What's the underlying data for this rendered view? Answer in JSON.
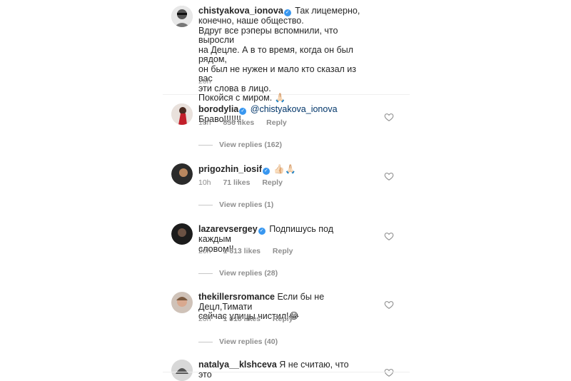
{
  "main_comment": {
    "username": "chistyakova_ionova",
    "lines": [
      "Так лицемерно,",
      "конечно, наше общество.",
      "Вдруг все рэперы вспомнили, что выросли",
      "на Децле. А в то время, когда он был рядом,",
      "он был не нужен и мало кто сказал из вас",
      "эти слова в лицо.",
      "Покойся с миром. 🙏🏻"
    ],
    "time": "20h"
  },
  "replies": [
    {
      "username": "borodylia",
      "mention": "@chistyakova_ionova",
      "text": " Браво!!!!!!!",
      "time": "18h",
      "likes": "856 likes",
      "reply_label": "Reply",
      "view_replies": "View replies (162)"
    },
    {
      "username": "prigozhin_iosif",
      "text": "👍🏻🙏🏻",
      "time": "10h",
      "likes": "71 likes",
      "reply_label": "Reply",
      "view_replies": "View replies (1)"
    },
    {
      "username": "lazarevsergey",
      "text": "Подпишусь под каждым",
      "text2": "словом!!",
      "time": "20h",
      "likes": "1 613 likes",
      "reply_label": "Reply",
      "view_replies": "View replies (28)"
    },
    {
      "username": "thekillersromance",
      "text": "Если бы не Децл,Тимати",
      "text2": "сейчас улицы чистил!😂",
      "time": "20h",
      "likes": "1 018 likes",
      "reply_label": "Reply",
      "view_replies": "View replies (40)"
    },
    {
      "username": "natalya__klshceva",
      "text": "Я не считаю, что это"
    }
  ],
  "colors": {
    "verified": "#3897f0",
    "secondary_text": "#8e8e8e"
  },
  "icons": {
    "verified": "verified-badge-icon",
    "like": "heart-outline-icon"
  }
}
